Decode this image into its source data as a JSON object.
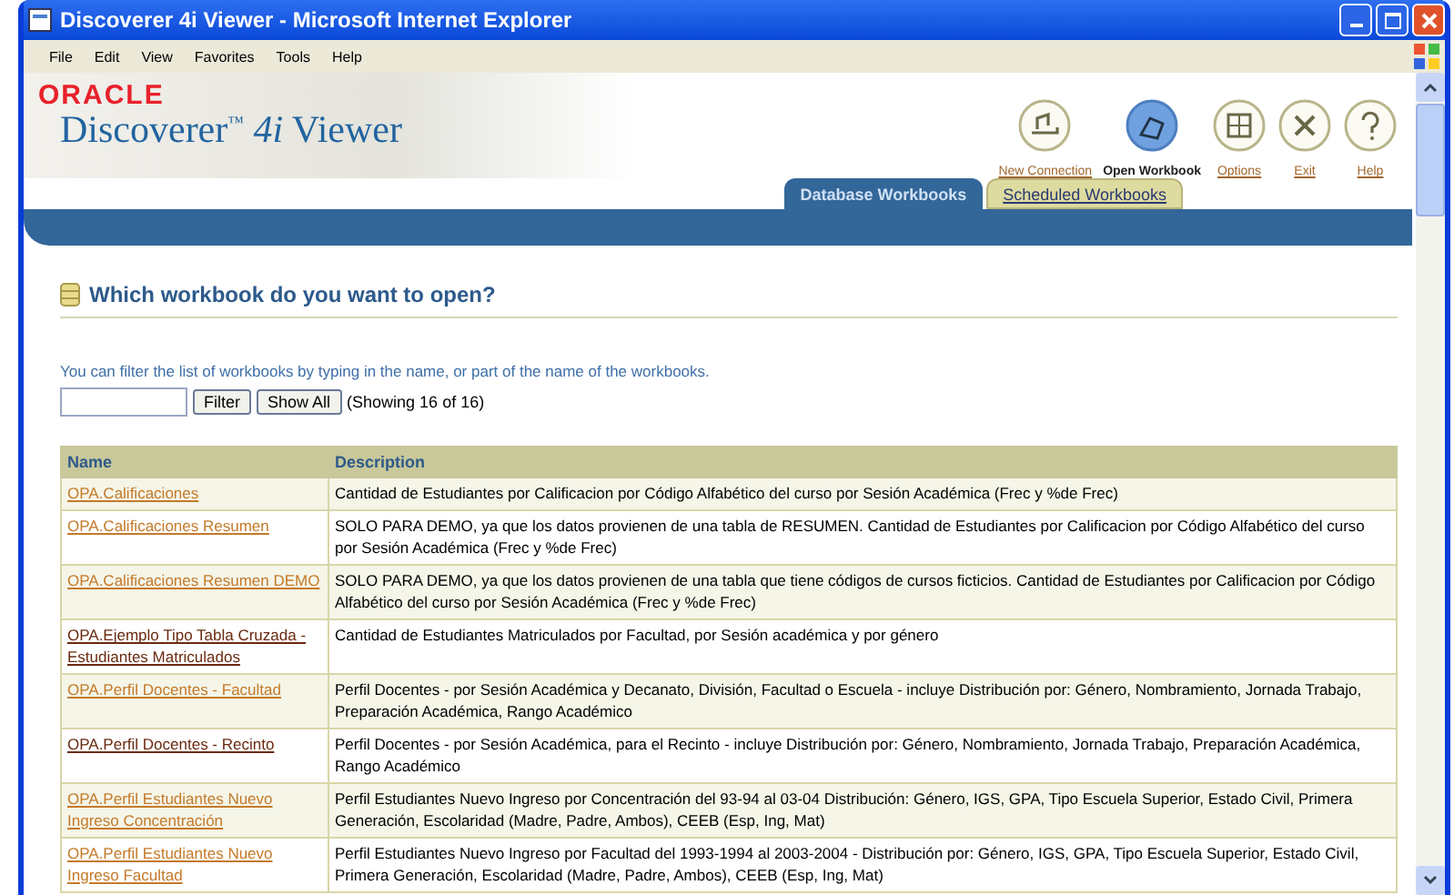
{
  "window": {
    "title": "Discoverer 4i Viewer - Microsoft Internet Explorer"
  },
  "menu": [
    "File",
    "Edit",
    "View",
    "Favorites",
    "Tools",
    "Help"
  ],
  "brand": {
    "company": "ORACLE",
    "product": "Discoverer",
    "tm": "™",
    "version": "4i",
    "suffix": "Viewer"
  },
  "actions": [
    {
      "label": "New Connection",
      "selected": false,
      "kind": "connect"
    },
    {
      "label": "Open Workbook",
      "selected": true,
      "kind": "open"
    },
    {
      "label": "Options",
      "selected": false,
      "kind": "options"
    },
    {
      "label": "Exit",
      "selected": false,
      "kind": "exit"
    },
    {
      "label": "Help",
      "selected": false,
      "kind": "help"
    }
  ],
  "tabs": [
    {
      "label": "Database Workbooks",
      "selected": true
    },
    {
      "label": "Scheduled Workbooks",
      "selected": false
    }
  ],
  "heading": "Which workbook do you want to open?",
  "hint": "You can filter the list of workbooks by typing in the name, or part of the name of the workbooks.",
  "filter": {
    "button": "Filter",
    "show_all": "Show All",
    "count": "(Showing 16 of 16)"
  },
  "table": {
    "columns": [
      "Name",
      "Description"
    ],
    "rows": [
      {
        "name": "OPA.Calificaciones",
        "visited": false,
        "description": "Cantidad de Estudiantes por Calificacion por Código Alfabético del curso por Sesión Académica (Frec y %de Frec)"
      },
      {
        "name": "OPA.Calificaciones Resumen",
        "visited": false,
        "description": "SOLO PARA DEMO, ya que los datos provienen de una tabla de RESUMEN. Cantidad de Estudiantes por Calificacion por Código Alfabético del curso por Sesión Académica (Frec y %de Frec)"
      },
      {
        "name": "OPA.Calificaciones Resumen DEMO",
        "visited": false,
        "description": "SOLO PARA DEMO, ya que los datos provienen de una tabla que tiene códigos de cursos ficticios. Cantidad de Estudiantes por Calificacion por Código Alfabético del curso por Sesión Académica (Frec y %de Frec)"
      },
      {
        "name": "OPA.Ejemplo Tipo Tabla Cruzada - Estudiantes Matriculados",
        "visited": true,
        "description": "Cantidad de Estudiantes Matriculados por Facultad, por Sesión académica y por género"
      },
      {
        "name": "OPA.Perfil Docentes - Facultad",
        "visited": false,
        "description": "Perfil Docentes - por Sesión Académica y Decanato, División, Facultad o Escuela - incluye Distribución por: Género, Nombramiento, Jornada Trabajo, Preparación Académica, Rango Académico"
      },
      {
        "name": "OPA.Perfil Docentes - Recinto",
        "visited": true,
        "description": "Perfil Docentes - por Sesión Académica, para el Recinto - incluye Distribución por: Género, Nombramiento, Jornada Trabajo, Preparación Académica, Rango Académico"
      },
      {
        "name": "OPA.Perfil Estudiantes Nuevo Ingreso Concentración",
        "visited": false,
        "description": "Perfil Estudiantes Nuevo Ingreso por Concentración del 93-94 al 03-04 Distribución: Género, IGS, GPA, Tipo Escuela Superior, Estado Civil, Primera Generación, Escolaridad (Madre, Padre, Ambos), CEEB (Esp, Ing, Mat)"
      },
      {
        "name": "OPA.Perfil Estudiantes Nuevo Ingreso Facultad",
        "visited": false,
        "description": "Perfil Estudiantes Nuevo Ingreso por Facultad del 1993-1994 al 2003-2004 - Distribución por: Género, IGS, GPA, Tipo Escuela Superior, Estado Civil, Primera Generación, Escolaridad (Madre, Padre, Ambos), CEEB (Esp, Ing, Mat)"
      }
    ]
  }
}
